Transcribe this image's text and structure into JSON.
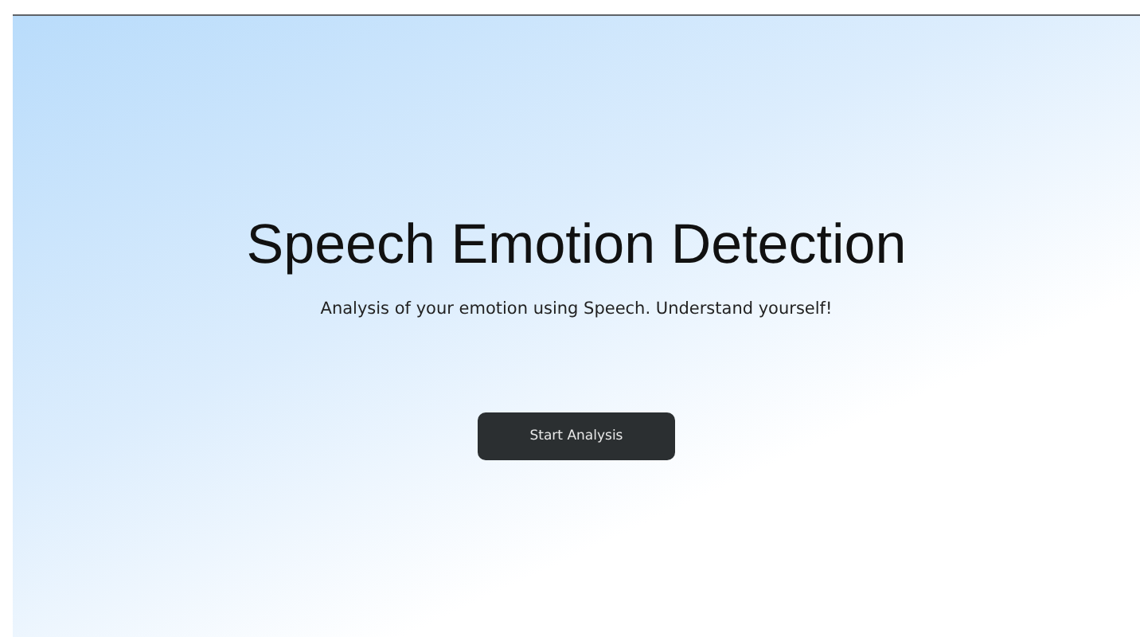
{
  "hero": {
    "title": "Speech Emotion Detection",
    "subtitle": "Analysis of your emotion using Speech. Understand yourself!",
    "button": "Start Analysis"
  }
}
